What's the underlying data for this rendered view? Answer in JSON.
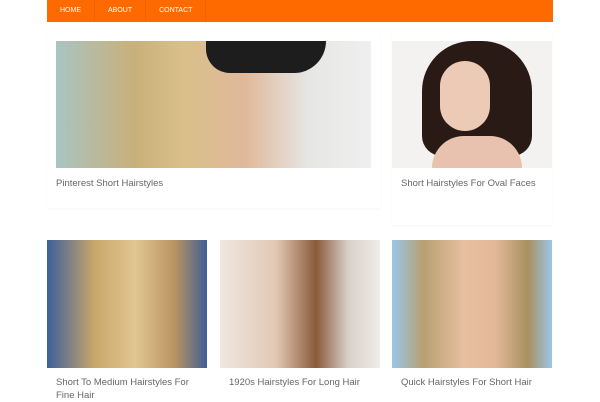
{
  "nav": {
    "items": [
      "Home",
      "About",
      "Contact"
    ]
  },
  "posts": [
    {
      "title": "Pinterest Short Hairstyles"
    },
    {
      "title": "Short Hairstyles For Oval Faces"
    },
    {
      "title": "Short To Medium Hairstyles For Fine Hair"
    },
    {
      "title": "1920s Hairstyles For Long Hair"
    },
    {
      "title": "Quick Hairstyles For Short Hair"
    }
  ],
  "colors": {
    "accent": "#ff6a00"
  }
}
